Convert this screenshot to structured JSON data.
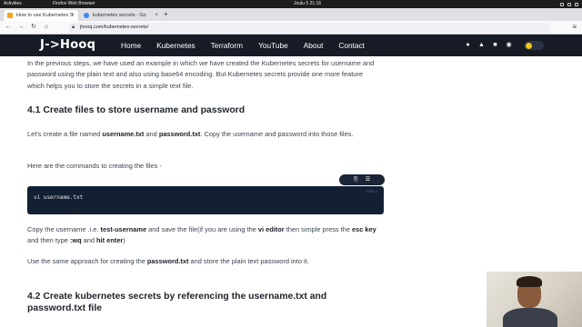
{
  "desktop": {
    "activities": "Activities",
    "app_name": "Firefox Web Browser",
    "clock": "Joulu 5  21:16"
  },
  "browser": {
    "tabs": [
      {
        "title": "How to use Kubernetes S",
        "active": true,
        "favicon_color": "#f7a21b"
      },
      {
        "title": "kubernetes secrets - Go",
        "active": false,
        "favicon_color": "#4285f4"
      }
    ],
    "new_tab": "+",
    "url": "jhooq.com/kubernetes-secrets/"
  },
  "site": {
    "logo": "J->Hooq",
    "nav": [
      "Home",
      "Kubernetes",
      "Terraform",
      "YouTube",
      "About",
      "Contact"
    ],
    "social_icons": [
      "github-icon",
      "twitter-icon",
      "linkedin-icon",
      "rss-icon"
    ]
  },
  "article": {
    "intro": "In the previous steps, we have used an example in which we have created the Kubernetes secrets for username and password using the plain text and also using base64 encoding. But Kubernetes secrets provide one more feature which helps you to store the secrets in a simple text file.",
    "heading_4_1": "4.1 Create files to store username and password",
    "p_create_files": {
      "t1": "Let's create a file named ",
      "b1": "username.txt",
      "t2": " and ",
      "b2": "password.txt",
      "t3": ". Copy the username and password into those files."
    },
    "commands_intro": "Here are the commands to creating the files -",
    "code": {
      "line": "vi username.txt",
      "lang": "SHELL"
    },
    "p_copy": {
      "t1": "Copy the username .i.e. ",
      "b1": "test-username",
      "t2": " and save the file(if you are using the ",
      "b2": "vi editor",
      "t3": " then simple press the ",
      "b3": "esc key",
      "t4": " and then type ",
      "b4": ":wq",
      "t5": " and ",
      "b5": "hit enter",
      "t6": ")"
    },
    "p_same": {
      "t1": "Use the same approach for creating the ",
      "b1": "password.txt",
      "t2": " and store the plain text password into it."
    },
    "heading_4_2": "4.2 Create kubernetes secrets by referencing the username.txt and password.txt file"
  }
}
